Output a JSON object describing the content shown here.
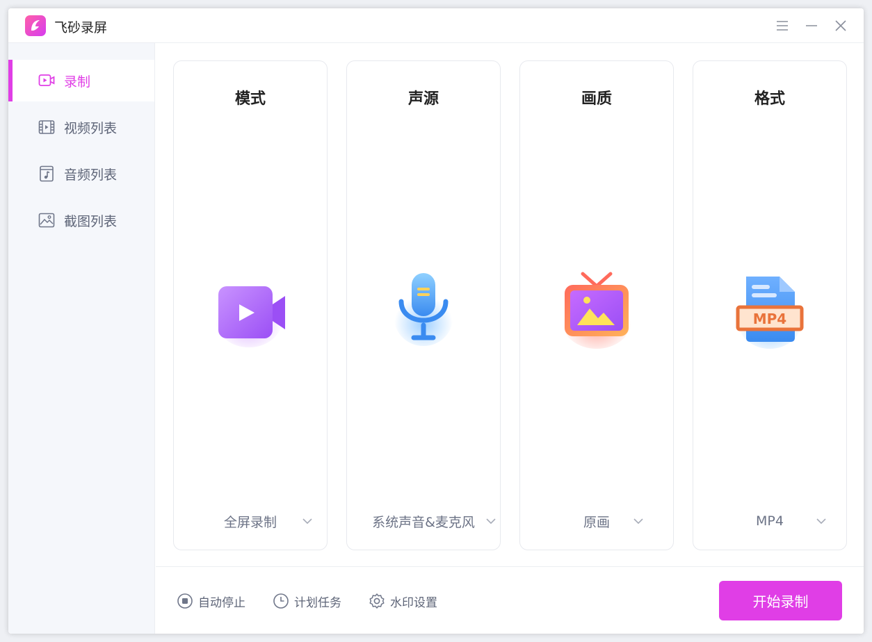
{
  "app": {
    "title": "飞砂录屏"
  },
  "colors": {
    "accent": "#e03ee6",
    "text_muted": "#6c7386"
  },
  "sidebar": {
    "items": [
      {
        "label": "录制",
        "icon": "video-record-icon",
        "active": true
      },
      {
        "label": "视频列表",
        "icon": "film-icon",
        "active": false
      },
      {
        "label": "音频列表",
        "icon": "music-file-icon",
        "active": false
      },
      {
        "label": "截图列表",
        "icon": "image-icon",
        "active": false
      }
    ]
  },
  "cards": [
    {
      "title": "模式",
      "value": "全屏录制",
      "icon": "video-camera-icon"
    },
    {
      "title": "声源",
      "value": "系统声音&麦克风",
      "icon": "microphone-icon"
    },
    {
      "title": "画质",
      "value": "原画",
      "icon": "tv-image-icon"
    },
    {
      "title": "格式",
      "value": "MP4",
      "icon": "mp4-file-icon",
      "badge": "MP4"
    }
  ],
  "footer": {
    "auto_stop": "自动停止",
    "schedule": "计划任务",
    "watermark": "水印设置",
    "start": "开始录制"
  }
}
